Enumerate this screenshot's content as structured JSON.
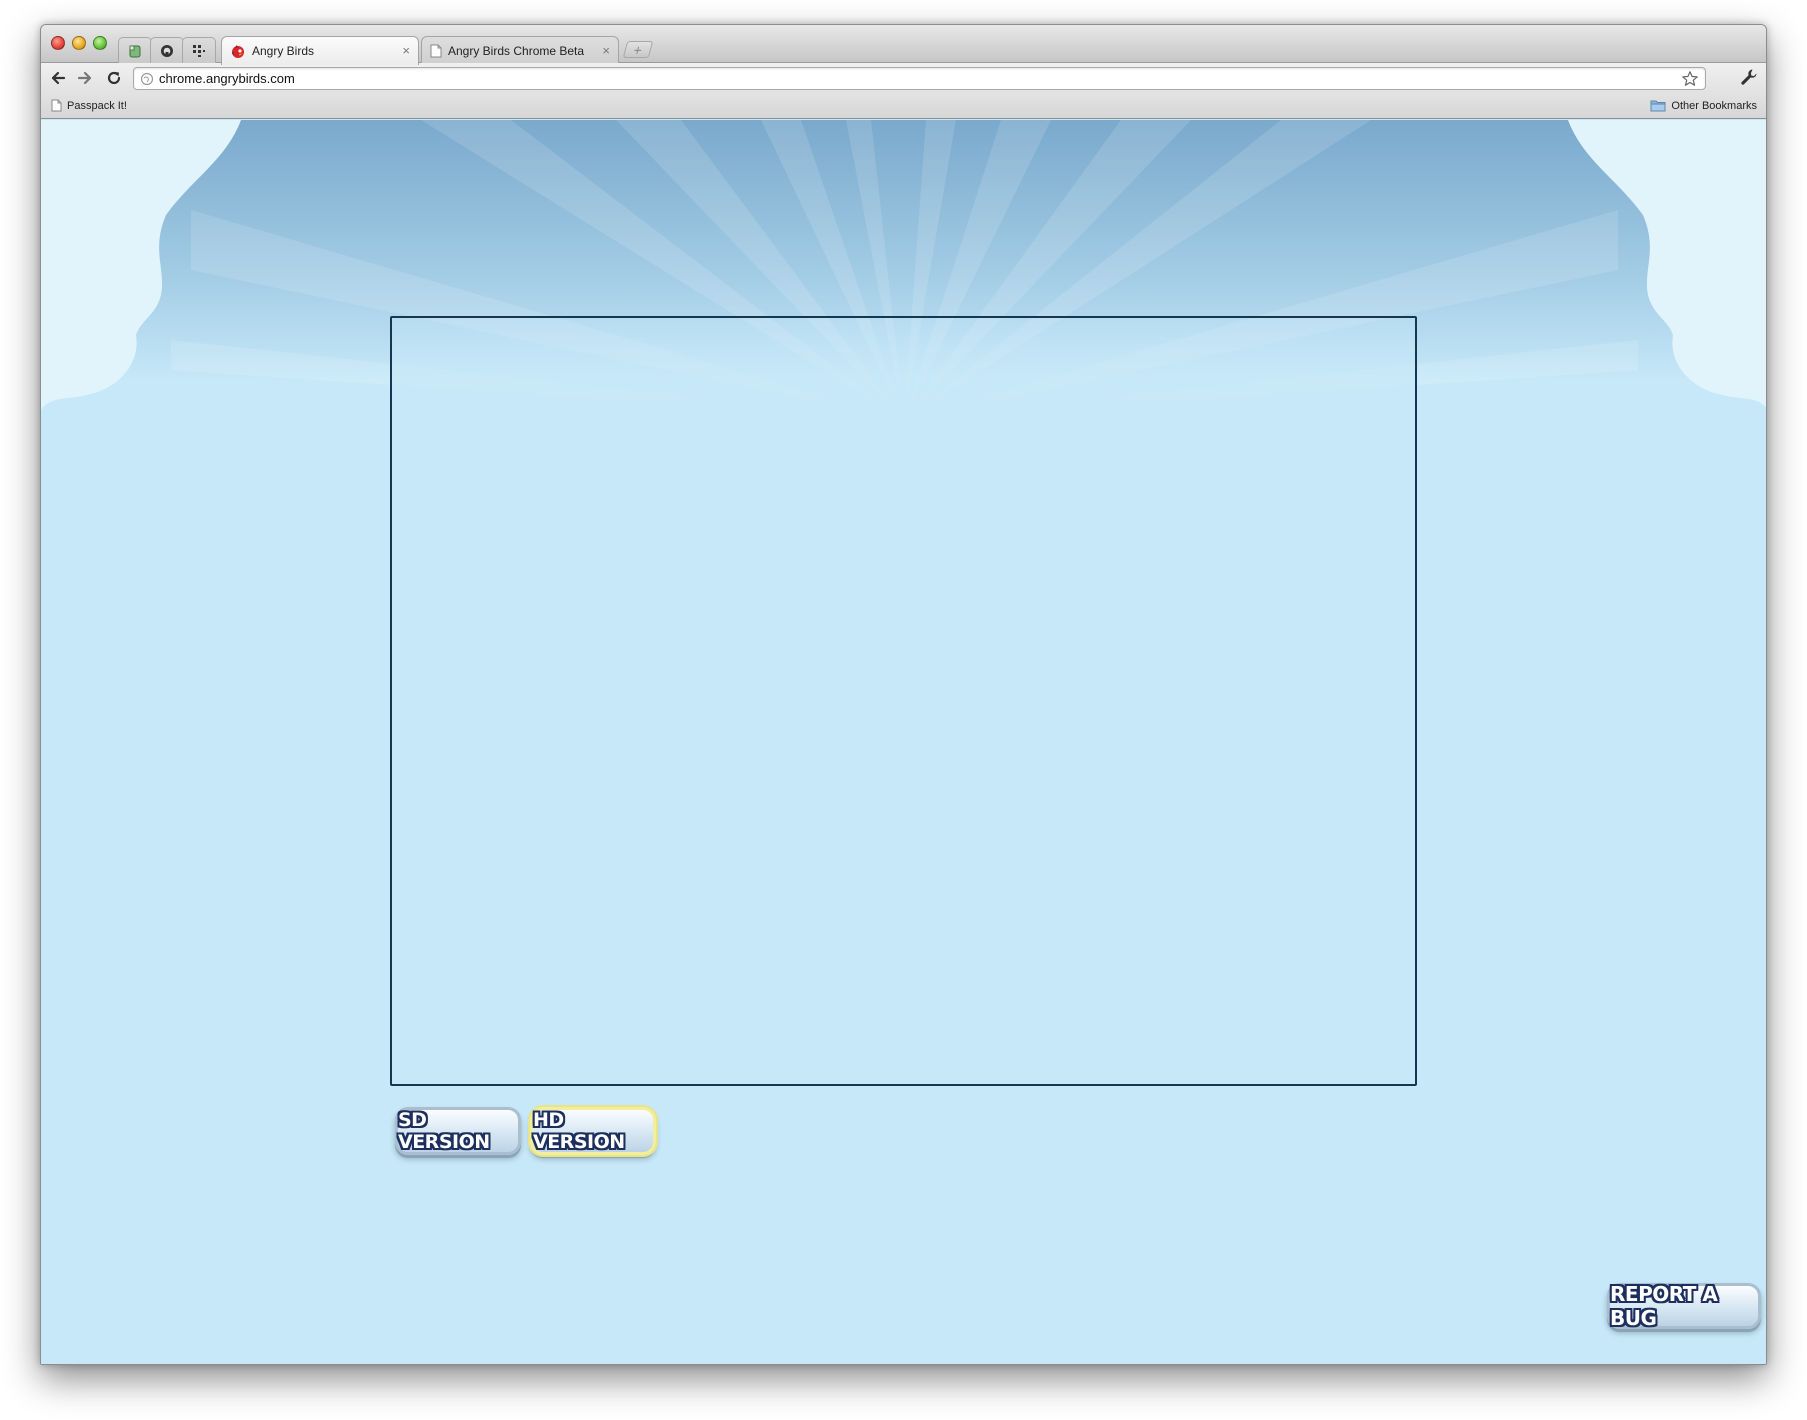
{
  "browser": {
    "tabs": [
      {
        "title": "Angry Birds",
        "active": true,
        "icon": "angry-bird-favicon-icon"
      },
      {
        "title": "Angry Birds Chrome Beta",
        "active": false,
        "icon": "page-icon"
      }
    ],
    "close_glyph": "×",
    "new_tab_glyph": "+",
    "extension_icons": [
      "evernote-icon",
      "github-icon",
      "grid-app-icon"
    ],
    "address": {
      "url": "chrome.angrybirds.com"
    },
    "bookmarks": {
      "items": [
        {
          "label": "Passpack It!",
          "icon": "page-icon"
        }
      ],
      "other_label": "Other Bookmarks"
    }
  },
  "page": {
    "buttons": {
      "sd_label": "SD VERSION",
      "hd_label": "HD VERSION",
      "report_bug_label": "REPORT A BUG"
    },
    "colors": {
      "sky": "#c6e8f8",
      "sky_top": "#7aa9cc",
      "cloud": "#e1f4fb",
      "frame_border": "#13384f",
      "button_outline": "#1c2f5e",
      "hd_highlight": "#e8e48a"
    }
  }
}
